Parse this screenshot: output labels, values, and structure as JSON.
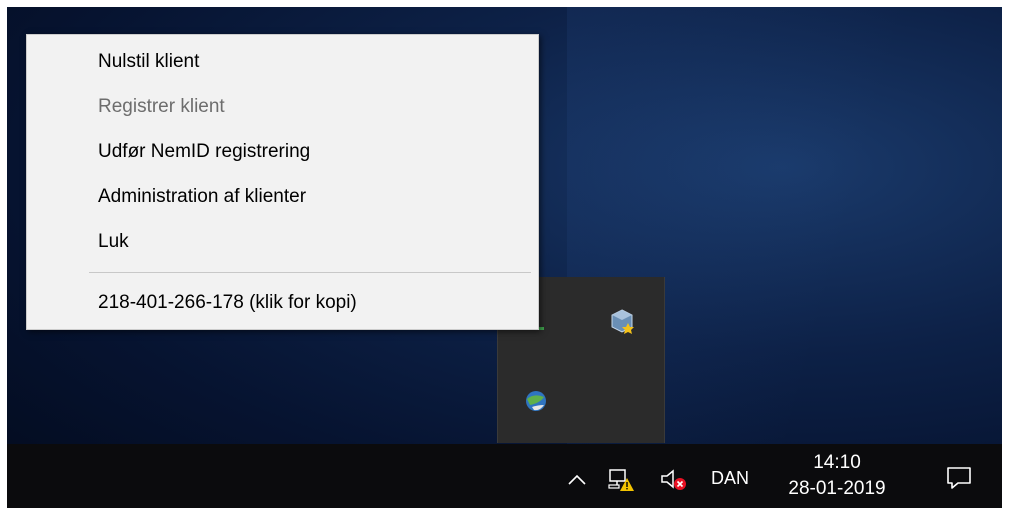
{
  "context_menu": {
    "items": [
      {
        "label": "Nulstil klient",
        "enabled": true
      },
      {
        "label": "Registrer klient",
        "enabled": false
      },
      {
        "label": "Udfør NemID registrering",
        "enabled": true
      },
      {
        "label": "Administration af klienter",
        "enabled": true
      },
      {
        "label": "Luk",
        "enabled": true
      }
    ],
    "footer_item": {
      "label": "218-401-266-178 (klik for kopi)"
    }
  },
  "tray_overflow": {
    "icons": [
      "nvidia-style-app-icon",
      "virtualbox-icon",
      "globe-app-icon"
    ]
  },
  "taskbar": {
    "show_hidden_icon": "chevron-up-icon",
    "network_icon": "network-warning-icon",
    "volume_icon": "volume-muted-icon",
    "language": "DAN",
    "time": "14:10",
    "date": "28-01-2019",
    "notification_icon": "action-center-icon"
  },
  "colors": {
    "menu_background": "#f2f2f2",
    "menu_disabled_text": "#6d6d6d",
    "taskbar_background": "#0b0b0d",
    "tray_overflow_background": "#2b2b2b",
    "warning_yellow": "#f2c300",
    "muted_red": "#e81123"
  }
}
